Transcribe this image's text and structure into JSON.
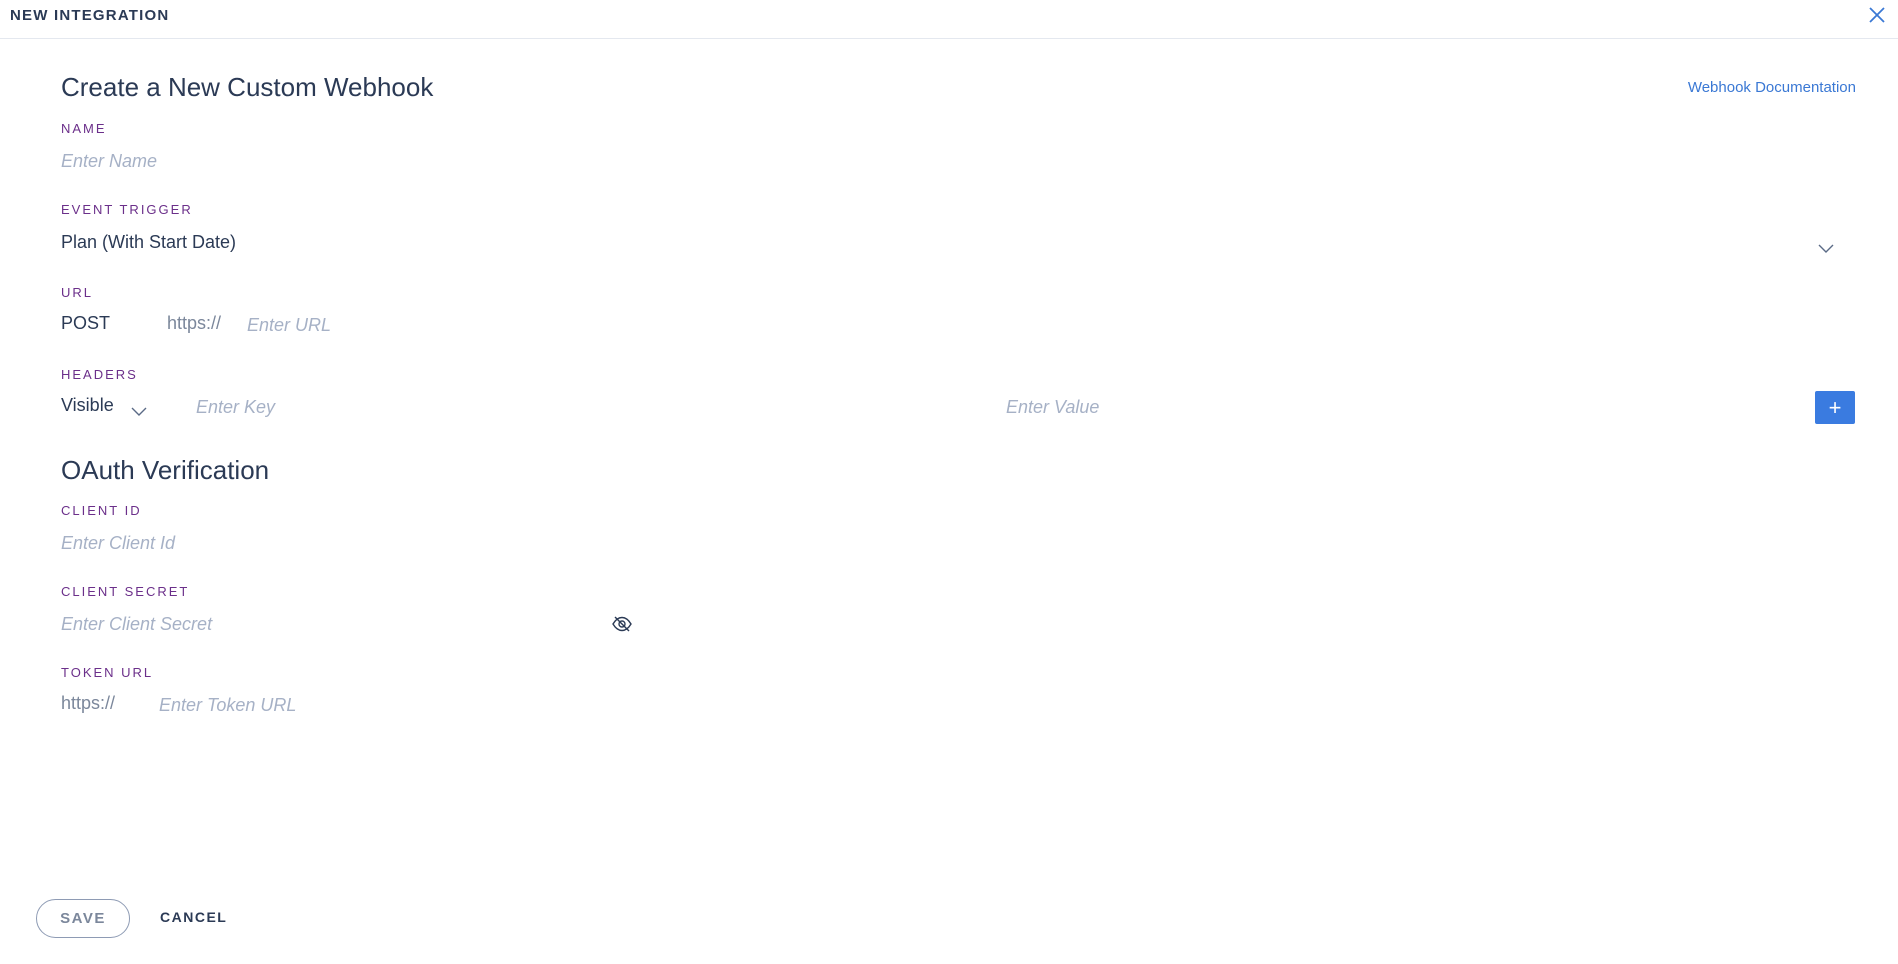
{
  "header": {
    "title": "NEW INTEGRATION",
    "close_icon": "close-icon"
  },
  "webhook": {
    "title": "Create a New Custom Webhook",
    "doc_link": "Webhook Documentation",
    "name": {
      "label": "NAME",
      "placeholder": "Enter Name",
      "value": ""
    },
    "event_trigger": {
      "label": "EVENT TRIGGER",
      "selected": "Plan (With Start Date)"
    },
    "url": {
      "label": "URL",
      "method": "POST",
      "prefix": "https://",
      "placeholder": "Enter URL",
      "value": ""
    },
    "headers": {
      "label": "HEADERS",
      "visibility": "Visible",
      "key_placeholder": "Enter Key",
      "value_placeholder": "Enter Value",
      "add_label": "+"
    }
  },
  "oauth": {
    "title": "OAuth Verification",
    "client_id": {
      "label": "CLIENT ID",
      "placeholder": "Enter Client Id",
      "value": ""
    },
    "client_secret": {
      "label": "CLIENT SECRET",
      "placeholder": "Enter Client Secret",
      "value": ""
    },
    "token_url": {
      "label": "TOKEN URL",
      "prefix": "https://",
      "placeholder": "Enter Token URL",
      "value": ""
    }
  },
  "footer": {
    "save_label": "SAVE",
    "cancel_label": "CANCEL"
  },
  "colors": {
    "accent": "#3a7be0",
    "label": "#6b2f8a",
    "text": "#2b3a55",
    "placeholder": "#a6b1c6"
  }
}
